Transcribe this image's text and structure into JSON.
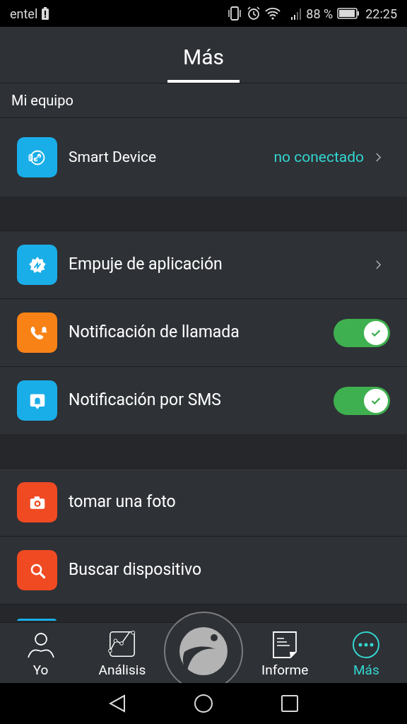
{
  "status_bar": {
    "carrier": "entel",
    "battery": "88 %",
    "time": "22:25"
  },
  "header": {
    "title": "Más"
  },
  "sections": [
    {
      "label": "Mi equipo",
      "rows": [
        {
          "kind": "link",
          "label": "Smart Device",
          "value": "no conectado",
          "color": "#1aaee8"
        }
      ]
    },
    {
      "rows": [
        {
          "kind": "link",
          "label": "Empuje de aplicación",
          "color": "#1aaee8"
        },
        {
          "kind": "toggle",
          "label": "Notificación de llamada",
          "on": true,
          "color": "#f98216"
        },
        {
          "kind": "toggle",
          "label": "Notificación por SMS",
          "on": true,
          "color": "#1aaee8"
        }
      ]
    },
    {
      "rows": [
        {
          "kind": "plain",
          "label": "tomar una foto",
          "color": "#f04a23"
        },
        {
          "kind": "plain",
          "label": "Buscar dispositivo",
          "color": "#f04a23"
        },
        {
          "kind": "partial",
          "color": "#1aaee8"
        }
      ]
    }
  ],
  "bottom_nav": [
    {
      "label": "Yo",
      "selected": false
    },
    {
      "label": "Análisis",
      "selected": false
    },
    {
      "kind": "center"
    },
    {
      "label": "Informe",
      "selected": false
    },
    {
      "label": "Más",
      "selected": true
    }
  ]
}
